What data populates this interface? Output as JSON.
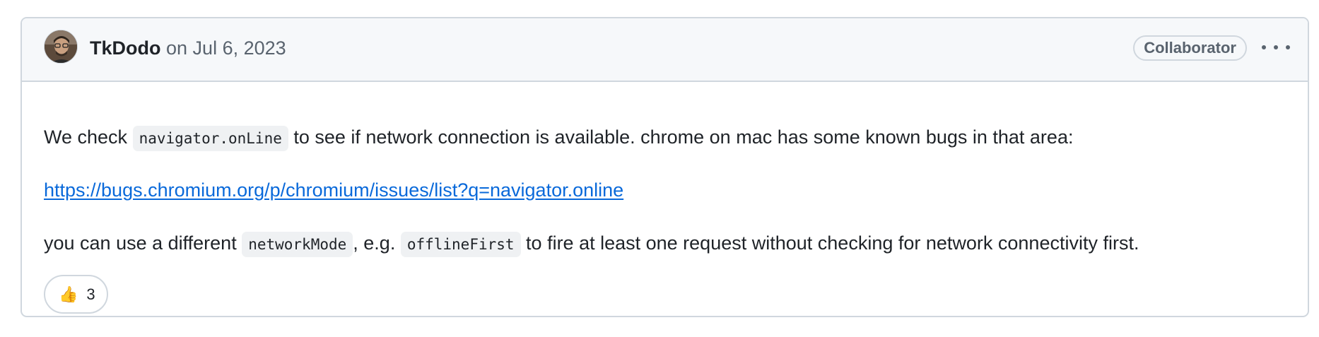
{
  "comment": {
    "author": "TkDodo",
    "date_text": "on Jul 6, 2023",
    "role_badge": "Collaborator",
    "body": {
      "p1_before": "We check ",
      "p1_code": "navigator.onLine",
      "p1_after": " to see if network connection is available. chrome on mac has some known bugs in that area:",
      "link_text": "https://bugs.chromium.org/p/chromium/issues/list?q=navigator.online",
      "p3_before": "you can use a different ",
      "p3_code1": "networkMode",
      "p3_mid": ", e.g. ",
      "p3_code2": "offlineFirst",
      "p3_after": " to fire at least one request without checking for network connectivity first."
    },
    "reactions": [
      {
        "icon": "thumbs-up-icon",
        "emoji": "👍",
        "count": "3"
      }
    ]
  },
  "colors": {
    "border": "#d0d7de",
    "header_bg": "#f6f8fa",
    "link": "#0969da",
    "muted_text": "#59636e",
    "code_bg": "#eff1f3"
  }
}
